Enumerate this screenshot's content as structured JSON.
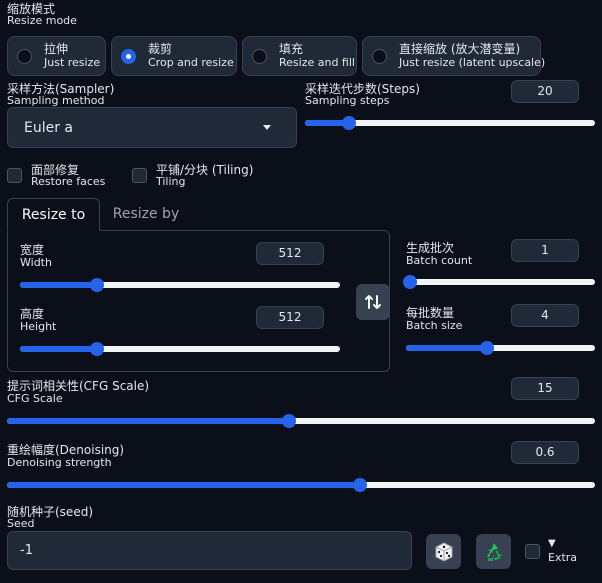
{
  "resize_mode": {
    "label_zh": "缩放模式",
    "label_en": "Resize mode",
    "options": [
      {
        "zh": "拉伸",
        "en": "Just resize",
        "selected": false
      },
      {
        "zh": "裁剪",
        "en": "Crop and resize",
        "selected": true
      },
      {
        "zh": "填充",
        "en": "Resize and fill",
        "selected": false
      },
      {
        "zh": "直接缩放 (放大潜变量)",
        "en": "Just resize (latent upscale)",
        "selected": false
      }
    ]
  },
  "sampler": {
    "label_zh": "采样方法(Sampler)",
    "label_en": "Sampling method",
    "value": "Euler a"
  },
  "steps": {
    "label_zh": "采样迭代步数(Steps)",
    "label_en": "Sampling steps",
    "value": "20",
    "fraction": 0.15
  },
  "restore_faces": {
    "label_zh": "面部修复",
    "label_en": "Restore faces",
    "checked": false
  },
  "tiling": {
    "label_zh": "平铺/分块 (Tiling)",
    "label_en": "Tiling",
    "checked": false
  },
  "tabs": {
    "active": "Resize to",
    "inactive": "Resize by"
  },
  "width": {
    "label_zh": "宽度",
    "label_en": "Width",
    "value": "512",
    "fraction": 0.24
  },
  "height": {
    "label_zh": "高度",
    "label_en": "Height",
    "value": "512",
    "fraction": 0.24
  },
  "batch_count": {
    "label_zh": "生成批次",
    "label_en": "Batch count",
    "value": "1",
    "fraction": 0.02
  },
  "batch_size": {
    "label_zh": "每批数量",
    "label_en": "Batch size",
    "value": "4",
    "fraction": 0.43
  },
  "cfg_scale": {
    "label_zh": "提示词相关性(CFG Scale)",
    "label_en": "CFG Scale",
    "value": "15",
    "fraction": 0.48
  },
  "denoising": {
    "label_zh": "重绘幅度(Denoising)",
    "label_en": "Denoising strength",
    "value": "0.6",
    "fraction": 0.6
  },
  "seed": {
    "label_zh": "随机种子(seed)",
    "label_en": "Seed",
    "value": "-1"
  },
  "extra": {
    "arrow": "▼",
    "label": "Extra",
    "checked": false
  },
  "colors": {
    "accent": "#2563eb",
    "background": "#0b0f19",
    "panel": "#1f2937",
    "border": "#374151"
  }
}
